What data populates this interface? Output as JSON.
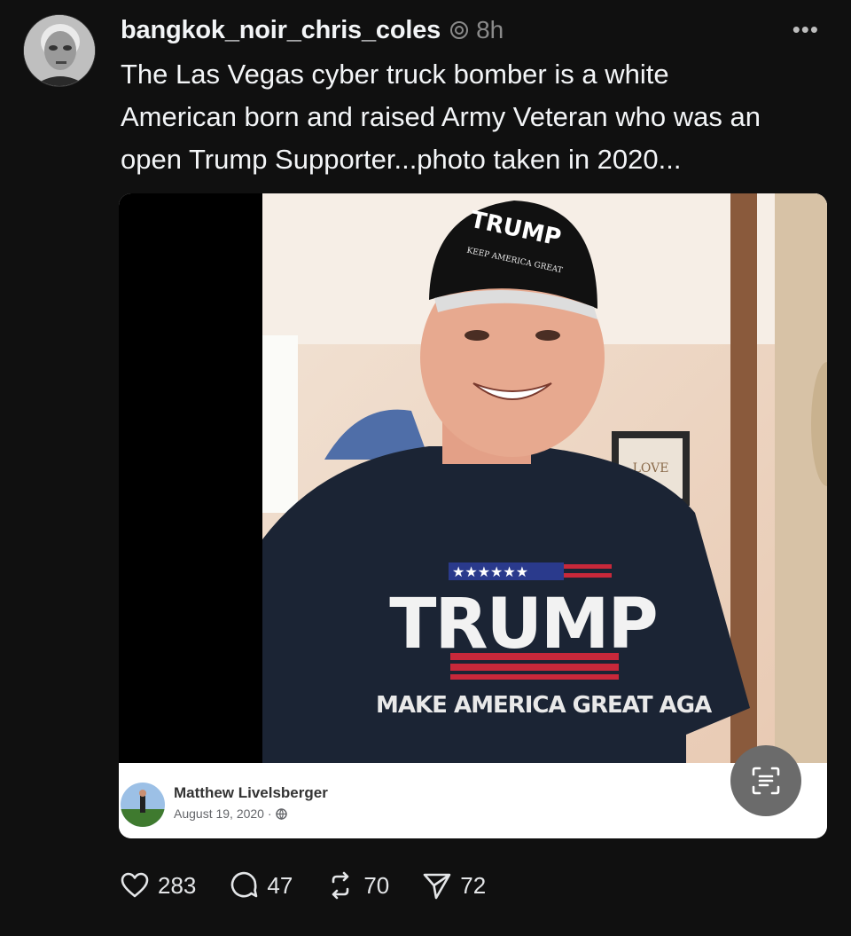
{
  "post": {
    "username": "bangkok_noir_chris_coles",
    "time": "8h",
    "more_label": "•••",
    "caption": "The Las Vegas cyber truck bomber is a white\nAmerican born and raised Army Veteran who was an\nopen Trump Supporter...photo taken in 2020..."
  },
  "photo": {
    "cap_text_1": "TRUMP",
    "cap_text_2": "KEEP AMERICA GREAT",
    "shirt_text_1": "TRUMP",
    "shirt_text_2": "MAKE AMERICA GREAT AGA",
    "sign_text": "LOVE"
  },
  "fb_card": {
    "name": "Matthew Livelsberger",
    "date": "August 19, 2020 ·"
  },
  "actions": {
    "likes": "283",
    "replies": "47",
    "reposts": "70",
    "shares": "72"
  },
  "colors": {
    "background": "#101010",
    "text": "#f3f5f7",
    "muted": "#8a8a8a",
    "shirt": "#1b2434",
    "flag_red": "#c8283a",
    "flag_blue": "#2a3a8c"
  }
}
